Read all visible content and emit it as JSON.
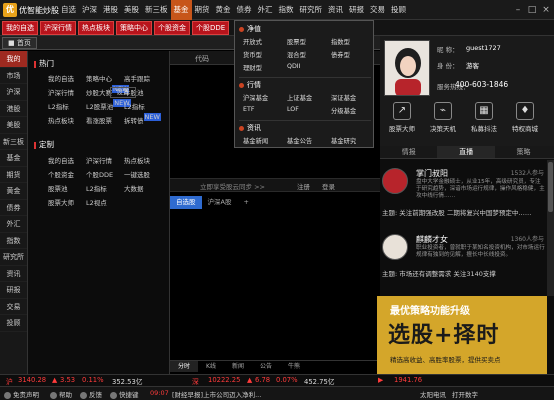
{
  "app": {
    "name": "优智能炒股"
  },
  "menu": [
    "自选",
    "沪深",
    "港股",
    "美股",
    "新三板",
    "基金",
    "期货",
    "黄金",
    "债券",
    "外汇",
    "指数",
    "研究所",
    "资讯",
    "研报",
    "交易",
    "投顾"
  ],
  "menu_active": "基金",
  "toolbar": [
    "我的自选",
    "沪深行情",
    "热点板块",
    "策略中心",
    "个股资金",
    "个股DDE"
  ],
  "home_tab": "首页",
  "leftnav": [
    "我的",
    "市场",
    "沪深",
    "港股",
    "美股",
    "新三板",
    "基金",
    "期货",
    "黄金",
    "债券",
    "外汇",
    "指数",
    "研究所",
    "资讯",
    "研报",
    "交易",
    "投顾"
  ],
  "hot": {
    "title": "热门",
    "items": [
      "我的自选",
      "策略中心",
      "高手跟踪",
      "沪深行情",
      "炒股大赛",
      "牛股池",
      "L2指标",
      "L2股票池",
      "L2指标",
      "热点板块",
      "看涨股票",
      "拆转债"
    ],
    "new_label": "NEW"
  },
  "custom": {
    "title": "定制",
    "settings": "设置",
    "items": [
      "我的自选",
      "沪深行情",
      "热点板块",
      "个股资金",
      "个股DDE",
      "一键选股",
      "股票池",
      "L2指标",
      "大数据",
      "股票大师",
      "L2视点"
    ]
  },
  "chart": {
    "code_label": "代码",
    "login_prompt": "立即享受股云同步 >>",
    "register": "注册",
    "login": "登录",
    "subtabs": [
      "自选股",
      "沪深A股",
      "+"
    ],
    "bottom_tabs": [
      "分时",
      "K线",
      "新闻",
      "公告",
      "牛熊"
    ]
  },
  "dropdown": {
    "sections": [
      {
        "title": "净值",
        "items": [
          "开放式",
          "股票型",
          "指数型",
          "货币型",
          "混合型",
          "债券型",
          "理财型",
          "QDII"
        ]
      },
      {
        "title": "行情",
        "items": [
          "沪深基金",
          "上证基金",
          "深证基金",
          "ETF",
          "LOF",
          "分级基金"
        ]
      },
      {
        "title": "资讯",
        "items": [
          "基金新闻",
          "基金公告",
          "基金研究"
        ]
      }
    ]
  },
  "user": {
    "nick_label": "昵  称：",
    "nick": "guest1727",
    "status_label": "身  份：",
    "status": "游客",
    "phone_label": "服务热线：",
    "phone": "400-603-1846"
  },
  "features": [
    "股票大师",
    "决策天机",
    "私募抖法",
    "特权商城"
  ],
  "right_tabs": [
    "情报",
    "直播",
    "策略"
  ],
  "right_tab_active": "直播",
  "posts": [
    {
      "name": "掌门叔阳",
      "fans": "1532人参与",
      "desc": "盘中大学金融硕士，从业15年，高级研究员，专注于研究趋势，深谙市场运行规律，操作风格稳健，主攻中线行情……",
      "topic": "主题: 关注前期强改股 二期将复兴中国梦预定中……"
    },
    {
      "name": "麒麟才女",
      "fans": "1360人参与",
      "desc": "职业投资者，曾就职于某知名投资机构，对市场运行规律有独到的见解，擅长中长线投资。",
      "topic": "主题: 市场还有调整需求 关注3140支撑"
    }
  ],
  "promo": {
    "title": "最优策略功能升级",
    "big": "选股+择时",
    "sub": "精选高收益、高胜率股票，提供买卖点"
  },
  "status": {
    "sh_label": "沪",
    "sh_value": "3140.28",
    "sh_change": "3.53",
    "sh_pct": "0.11%",
    "sh_amount": "352.53亿",
    "sz_label": "深",
    "sz_value": "10222.25",
    "sz_change": "6.78",
    "sz_pct": "0.07%",
    "sz_amount": "452.75亿",
    "cy_value": "1941.76"
  },
  "footer": [
    "免责声明",
    "帮助",
    "反馈",
    "快捷键",
    "09:07"
  ],
  "footer_news": "[财经早报]上市公司迈入净利...",
  "footer_right": [
    "太阳电讯",
    "打开数字"
  ],
  "colors": {
    "accent": "#c7551a",
    "red": "#ff3b3b",
    "toolbar_red": "#b8141c",
    "nav_active": "#9e2a20",
    "promo": "#d4a62a"
  }
}
